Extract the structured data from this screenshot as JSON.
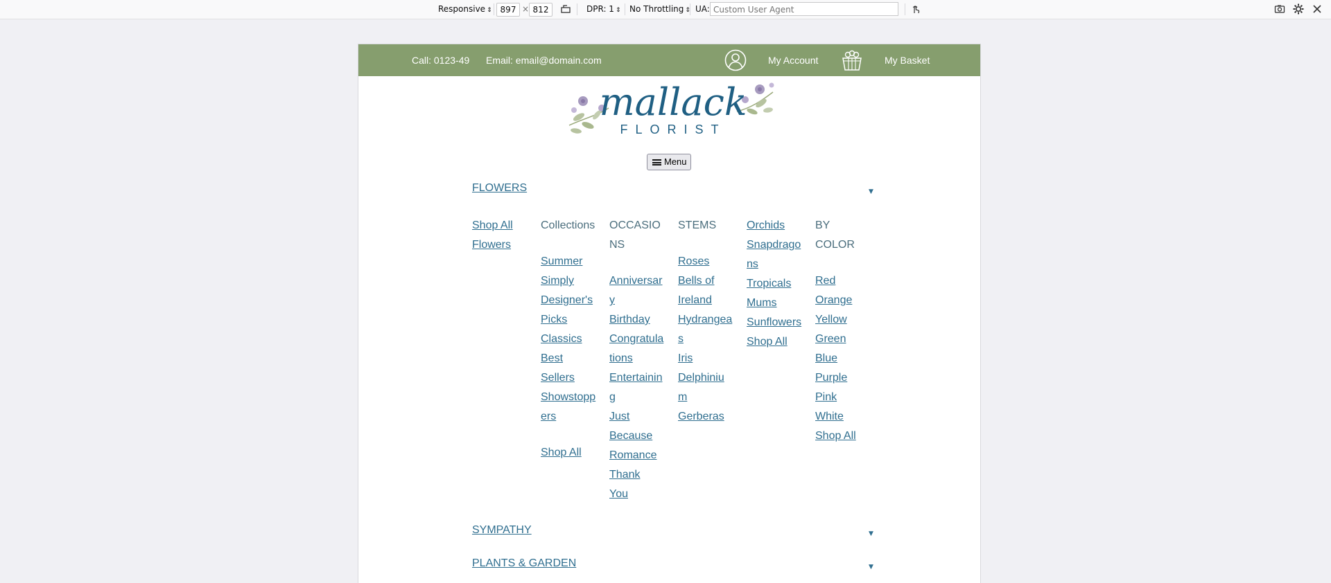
{
  "devtools": {
    "device_mode": "Responsive",
    "width": "897",
    "times": "×",
    "height": "812",
    "dpr": "DPR: 1",
    "throttling": "No Throttling",
    "ua_label": "UA:",
    "ua_placeholder": "Custom User Agent",
    "icons": [
      "rotate-icon",
      "touch-icon",
      "screenshot-icon",
      "settings-icon",
      "close-icon"
    ]
  },
  "header": {
    "phone": "Call: 0123-49",
    "email": "Email: email@domain.com",
    "account": "My Account",
    "basket": "My Basket",
    "bar_color": "#869e6e"
  },
  "logo": {
    "name": "mallack",
    "tagline": "FLORIST"
  },
  "menu_button": "Menu",
  "nav": {
    "flowers": "FLOWERS",
    "sympathy": "SYMPATHY",
    "plants": "PLANTS & GARDEN",
    "caret": "▼",
    "link_color": "#2f6e8f"
  },
  "columns": {
    "shop_all_flowers": [
      "Shop All",
      "Flowers"
    ],
    "collections": {
      "heading": "Collections",
      "items": [
        "Summer",
        "Simply",
        "Designer's Picks",
        "Classics",
        "Best",
        "Sellers",
        "Showstoppers"
      ],
      "shop_all": "Shop All"
    },
    "occasions": {
      "heading": "OCCASIONS",
      "items": [
        "Anniversary",
        "Birthday",
        "Congratulations",
        "Entertaining",
        "Just",
        "Because",
        "Romance",
        "Thank",
        "You"
      ]
    },
    "stems": {
      "heading": "STEMS",
      "items": [
        "Roses",
        "Bells of",
        "Ireland",
        "Hydrangeas",
        "Iris",
        "Delphinium",
        "Gerberas"
      ]
    },
    "orchids": {
      "items": [
        "Orchids",
        "Snapdragons",
        "Tropicals",
        "Mums",
        "Sunflowers",
        "Shop All"
      ]
    },
    "by_color": {
      "heading": [
        "BY",
        "COLOR"
      ],
      "items": [
        "Red",
        "Orange",
        "Yellow",
        "Green",
        "Blue",
        "Purple",
        "Pink",
        "White",
        "Shop All"
      ]
    }
  }
}
